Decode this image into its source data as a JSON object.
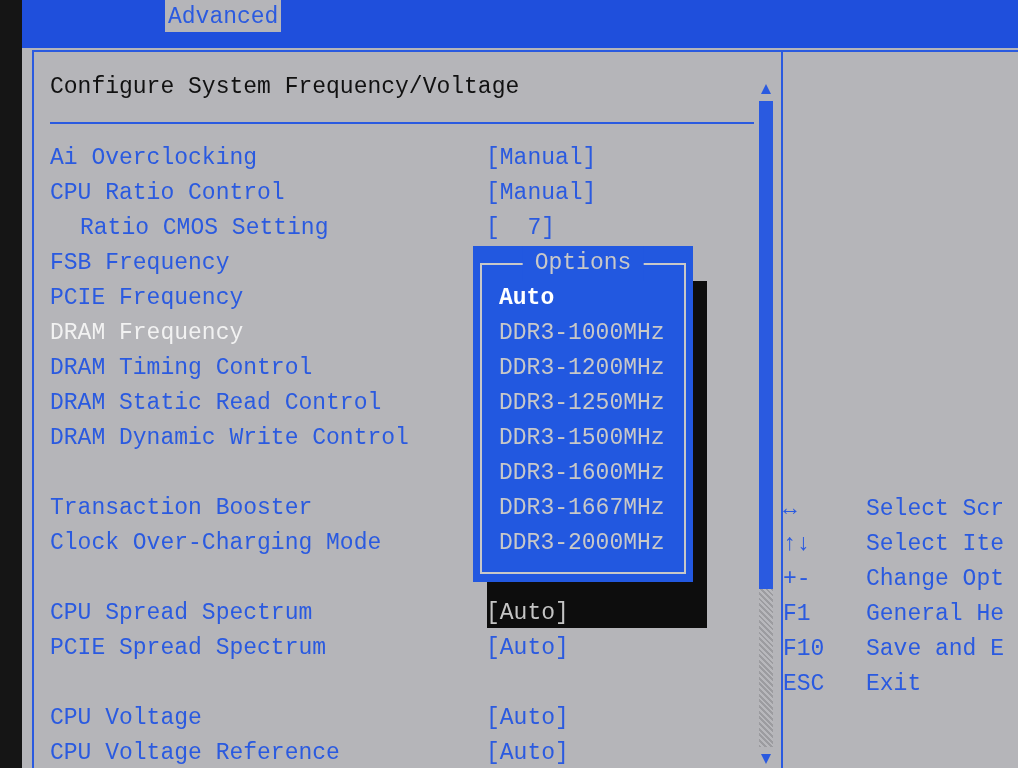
{
  "top_bar": {
    "tabs": [
      {
        "label": "Advanced",
        "selected": true
      }
    ]
  },
  "settings_panel": {
    "title": "Configure System Frequency/Voltage",
    "groups": [
      [
        {
          "label": "Ai Overclocking",
          "value": "[Manual]",
          "selected": false
        },
        {
          "label": "CPU Ratio Control",
          "value": "[Manual]",
          "selected": false,
          "children": [
            {
              "label": "Ratio CMOS Setting",
              "value": "[  7]",
              "selected": false
            }
          ]
        },
        {
          "label": "FSB Frequency",
          "selected": false
        },
        {
          "label": "PCIE Frequency",
          "selected": false
        },
        {
          "label": "DRAM Frequency",
          "selected": true
        },
        {
          "label": "DRAM Timing Control",
          "selected": false
        },
        {
          "label": "DRAM Static Read Control",
          "selected": false
        },
        {
          "label": "DRAM Dynamic Write Control",
          "selected": false
        }
      ],
      [
        {
          "label": "Transaction Booster",
          "selected": false
        },
        {
          "label": "Clock Over-Charging Mode",
          "selected": false
        }
      ],
      [
        {
          "label": "CPU Spread Spectrum",
          "value": "[Auto]",
          "selected": false
        },
        {
          "label": "PCIE Spread Spectrum",
          "value": "[Auto]",
          "selected": false
        }
      ],
      [
        {
          "label": "CPU Voltage",
          "value": "[Auto]",
          "selected": false
        },
        {
          "label": "CPU Voltage Reference",
          "value": "[Auto]",
          "selected": false
        }
      ]
    ]
  },
  "options_popup": {
    "title": "Options",
    "options": [
      {
        "label": "Auto",
        "selected": true
      },
      {
        "label": "DDR3-1000MHz",
        "selected": false
      },
      {
        "label": "DDR3-1200MHz",
        "selected": false
      },
      {
        "label": "DDR3-1250MHz",
        "selected": false
      },
      {
        "label": "DDR3-1500MHz",
        "selected": false
      },
      {
        "label": "DDR3-1600MHz",
        "selected": false
      },
      {
        "label": "DDR3-1667MHz",
        "selected": false
      },
      {
        "label": "DDR3-2000MHz",
        "selected": false
      }
    ]
  },
  "help_panel": {
    "keys": [
      {
        "key": "↔",
        "action": "Select Scr"
      },
      {
        "key": "↑↓",
        "action": "Select Ite"
      },
      {
        "key": "+-",
        "action": "Change Opt"
      },
      {
        "key": "F1",
        "action": "General He"
      },
      {
        "key": "F10",
        "action": "Save and E"
      },
      {
        "key": "ESC",
        "action": "Exit"
      }
    ]
  }
}
